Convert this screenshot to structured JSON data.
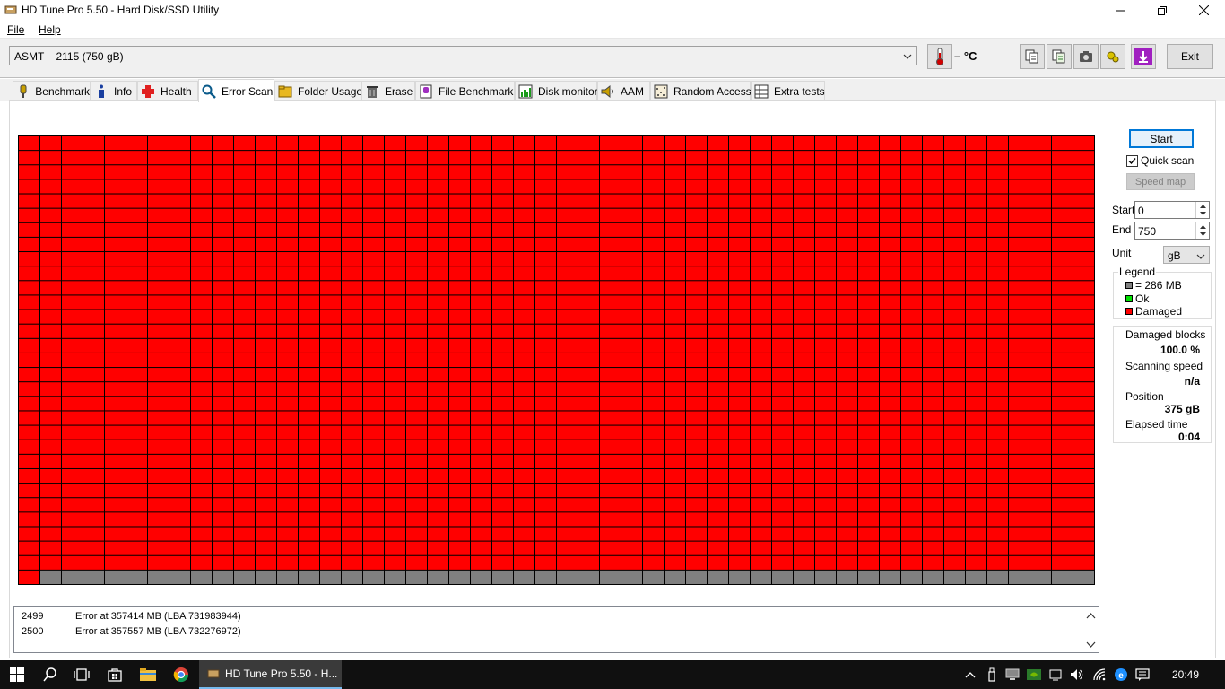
{
  "window": {
    "title": "HD Tune Pro 5.50 - Hard Disk/SSD Utility"
  },
  "menu": {
    "file": "File",
    "help": "Help"
  },
  "toolbar": {
    "drive": "ASMT    2115 (750 gB)",
    "temperature": "– °C",
    "exit_label": "Exit",
    "icons": [
      "copy-icon",
      "copy-all-icon",
      "screenshot-icon",
      "options-icon",
      "save-icon"
    ]
  },
  "tabs": [
    {
      "label": "Benchmark",
      "icon": "benchmark-icon"
    },
    {
      "label": "Info",
      "icon": "info-icon"
    },
    {
      "label": "Health",
      "icon": "health-icon"
    },
    {
      "label": "Error Scan",
      "icon": "error-scan-icon"
    },
    {
      "label": "Folder Usage",
      "icon": "folder-usage-icon"
    },
    {
      "label": "Erase",
      "icon": "erase-icon"
    },
    {
      "label": "File Benchmark",
      "icon": "file-benchmark-icon"
    },
    {
      "label": "Disk monitor",
      "icon": "disk-monitor-icon"
    },
    {
      "label": "AAM",
      "icon": "aam-icon"
    },
    {
      "label": "Random Access",
      "icon": "random-access-icon"
    },
    {
      "label": "Extra tests",
      "icon": "extra-tests-icon"
    }
  ],
  "active_tab": "Error Scan",
  "scan_grid": {
    "columns": 50,
    "rows": 31,
    "damaged_blocks": 1501,
    "colors": {
      "damaged": "#ff0000",
      "unscanned": "#808080",
      "ok": "#00e000",
      "border": "#000000"
    }
  },
  "controls": {
    "start_label": "Start",
    "quick_scan_label": "Quick scan",
    "quick_scan_checked": true,
    "speed_map_label": "Speed map",
    "start_field_label": "Start",
    "start_value": "0",
    "end_field_label": "End",
    "end_value": "750",
    "unit_label": "Unit",
    "unit_value": "gB"
  },
  "legend": {
    "title": "Legend",
    "block_size": "= 286 MB",
    "ok": "Ok",
    "damaged": "Damaged"
  },
  "stats": {
    "damaged_blocks_label": "Damaged blocks",
    "damaged_blocks_value": "100.0 %",
    "scanning_speed_label": "Scanning speed",
    "scanning_speed_value": "n/a",
    "position_label": "Position",
    "position_value": "375 gB",
    "elapsed_time_label": "Elapsed time",
    "elapsed_time_value": "0:04"
  },
  "log": [
    {
      "num": "2499",
      "text": "Error at 357414 MB (LBA 731983944)"
    },
    {
      "num": "2500",
      "text": "Error at 357557 MB (LBA 732276972)"
    }
  ],
  "taskbar": {
    "app_label": "HD Tune Pro 5.50 - H...",
    "clock": "20:49"
  }
}
